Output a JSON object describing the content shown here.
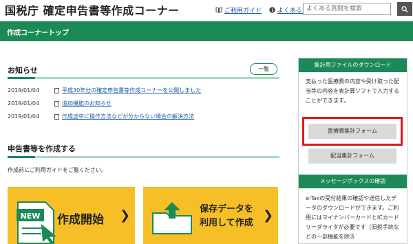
{
  "header": {
    "site_title": "国税庁 確定申告書等作成コーナー",
    "guide_link": "ご利用ガイド",
    "faq_link": "よくある質問",
    "search_placeholder": "よくある質問を検索"
  },
  "nav": {
    "title": "作成コーナートップ"
  },
  "news": {
    "title": "お知らせ",
    "list_button": "一覧",
    "items": [
      {
        "date": "2019/01/04",
        "text": "平成30年分の確定申告書等作成コーナーを公開しました"
      },
      {
        "date": "2019/01/04",
        "text": "追加機能のお知らせ"
      },
      {
        "date": "2019/01/04",
        "text": "作成途中に操作方法などが分からない場合の解決方法"
      }
    ]
  },
  "create": {
    "title": "申告書等を作成する",
    "description": "作成前にご利用ガイドをご覧ください。",
    "start_button": "作成開始",
    "start_icon_text": "NEW",
    "saved_button_line1": "保存データを",
    "saved_button_line2": "利用して作成"
  },
  "sidebar": {
    "download_title": "集計用ファイルのダウンロード",
    "download_text": "支払った医療費の内容や受け取った配当等の内容を表計算ソフトで入力することができます。",
    "medical_button": "医療費集計フォーム",
    "dividend_button": "配当集計フォーム",
    "messagebox_title": "メッセージボックスの確認",
    "messagebox_text": "e-Taxの受付結果の確認や送信したデータのダウンロードができます。ご利用にはマイナンバーカードとICカードリーダライタが必要です（旧税手続などの一部機能を除き"
  },
  "colors": {
    "brand_green": "#1b8a56",
    "accent_yellow": "#f7bf27",
    "highlight_red": "#e01818"
  }
}
